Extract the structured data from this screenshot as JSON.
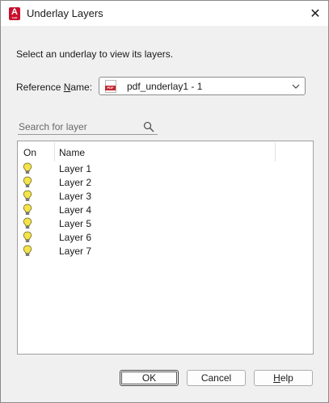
{
  "window": {
    "title": "Underlay Layers",
    "app_icon_letter": "A",
    "app_icon_sub": "CAD",
    "close_glyph": "✕"
  },
  "instruction": "Select an underlay to view its layers.",
  "reference": {
    "label_pre": "Reference ",
    "label_accel": "N",
    "label_post": "ame:",
    "selected_value": "pdf_underlay1 - 1",
    "file_icon_text": "PDF"
  },
  "search": {
    "placeholder": "Search for layer",
    "value": ""
  },
  "layers_table": {
    "columns": [
      "On",
      "Name"
    ],
    "rows": [
      {
        "on": true,
        "name": "Layer 1"
      },
      {
        "on": true,
        "name": "Layer 2"
      },
      {
        "on": true,
        "name": "Layer 3"
      },
      {
        "on": true,
        "name": "Layer 4"
      },
      {
        "on": true,
        "name": "Layer 5"
      },
      {
        "on": true,
        "name": "Layer 6"
      },
      {
        "on": true,
        "name": "Layer 7"
      }
    ]
  },
  "buttons": {
    "ok": "OK",
    "cancel": "Cancel",
    "help_accel": "H",
    "help_rest": "elp"
  },
  "colors": {
    "bulb_on": "#f5e34a",
    "brand": "#c8102e"
  },
  "icons": [
    "app-icon",
    "close-icon",
    "pdf-file-icon",
    "chevron-down-icon",
    "search-icon",
    "lightbulb-on-icon"
  ]
}
